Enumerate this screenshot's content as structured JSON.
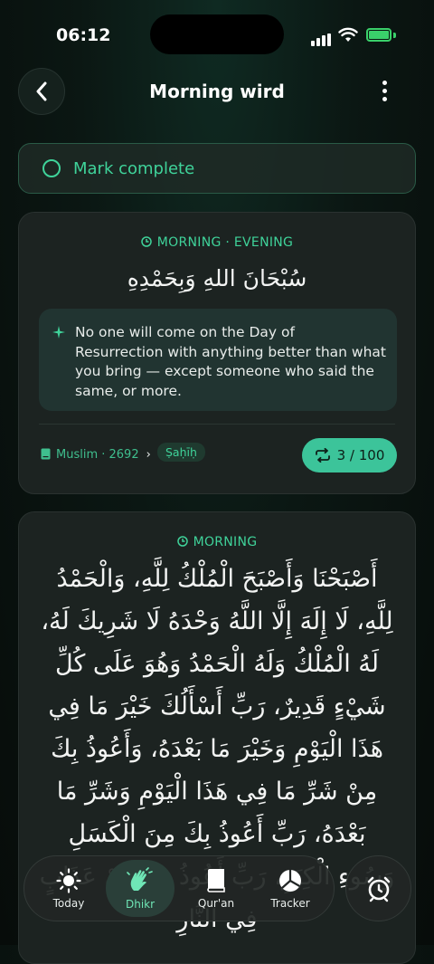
{
  "status_bar": {
    "time": "06:12"
  },
  "header": {
    "title": "Morning wird"
  },
  "mark_complete": {
    "label": "Mark complete"
  },
  "cards": [
    {
      "tag": "MORNING · EVENING",
      "arabic": "سُبْحَانَ اللهِ وَبِحَمْدِهِ",
      "virtue": "No one will come on the Day of Resurrection with anything better than what you bring — except someone who said the same, or more.",
      "source": "Muslim · 2692",
      "grade": "Ṣaḥīḥ",
      "counter": "3 / 100"
    },
    {
      "tag": "MORNING",
      "arabic": "أَصْبَحْنَا وَأَصْبَحَ الْمُلْكُ لِلَّهِ، وَالْحَمْدُ لِلَّهِ، لَا إِلَهَ إِلَّا اللَّهُ وَحْدَهُ لَا شَرِيكَ لَهُ، لَهُ الْمُلْكُ وَلَهُ الْحَمْدُ وَهُوَ عَلَى كُلِّ شَيْءٍ قَدِيرٌ، رَبِّ أَسْأَلُكَ خَيْرَ مَا فِي هَذَا الْيَوْمِ وَخَيْرَ مَا بَعْدَهُ، وَأَعُوذُ بِكَ مِنْ شَرِّ مَا فِي هَذَا الْيَوْمِ وَشَرِّ مَا بَعْدَهُ، رَبِّ أَعُوذُ بِكَ مِنَ الْكَسَلِ وَسُوءِ الْكِبَرِ، رَبِّ أَعُوذُ بِكَ مِنْ عَذَابٍ فِي النَّارِ"
    }
  ],
  "nav": {
    "items": [
      {
        "label": "Today",
        "icon": "sun-icon"
      },
      {
        "label": "Dhikr",
        "icon": "hands-icon"
      },
      {
        "label": "Qur'an",
        "icon": "book-icon"
      },
      {
        "label": "Tracker",
        "icon": "pie-chart-icon"
      }
    ],
    "active": "Dhikr",
    "alarm_icon": "alarm-clock-icon"
  },
  "colors": {
    "accent": "#3fd39a",
    "counter_bg": "#3cc49a",
    "card_bg": "#1c2321"
  }
}
